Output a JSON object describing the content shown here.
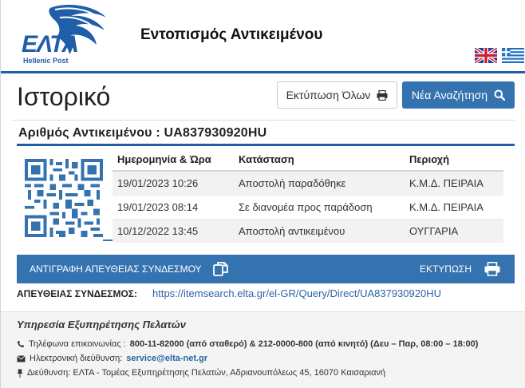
{
  "header": {
    "logo_text": "ΕΛΤΑ",
    "logo_subtext": "Hellenic Post",
    "title": "Εντοπισμός Αντικειμένου",
    "flags": [
      "uk-flag-icon",
      "greek-flag-icon"
    ]
  },
  "history": {
    "title": "Ιστορικό",
    "print_all_label": "Εκτύπωση Όλων",
    "new_search_label": "Νέα Αναζήτηση",
    "item_number_label": "Αριθμός Αντικειμένου : UA837930920HU"
  },
  "table": {
    "columns": [
      "Ημερομηνία & Ώρα",
      "Κατάσταση",
      "Περιοχή"
    ],
    "rows": [
      {
        "date": "19/01/2023 10:26",
        "status": "Αποστολή παραδόθηκε",
        "area": "Κ.Μ.Δ. ΠΕΙΡΑΙΑ"
      },
      {
        "date": "19/01/2023 08:14",
        "status": "Σε διανομέα προς παράδοση",
        "area": "Κ.Μ.Δ. ΠΕΙΡΑΙΑ"
      },
      {
        "date": "10/12/2022 13:45",
        "status": "Αποστολή αντικειμένου",
        "area": "ΟΥΓΓΑΡΙΑ"
      }
    ]
  },
  "actions": {
    "copy_link_label": "ΑΝΤΙΓΡΑΦΗ ΑΠΕΥΘΕΙΑΣ ΣΥΝΔΕΣΜΟΥ",
    "print_label": "ΕΚΤΥΠΩΣΗ"
  },
  "direct_link": {
    "label": "ΑΠΕΥΘΕΙΑΣ ΣΥΝΔΕΣΜΟΣ:",
    "url": "https://itemsearch.elta.gr/el-GR/Query/Direct/UA837930920HU"
  },
  "footer": {
    "title": "Υπηρεσία Εξυπηρέτησης Πελατών",
    "phone_label": "Τηλέφωνα επικοινωνίας :",
    "phone_value": "800-11-82000 (από σταθερό) & 212-0000-800 (από κινητό) (Δευ – Παρ, 08:00 – 18:00)",
    "email_label": "Ηλεκτρονική διεύθυνση:",
    "email_value": "service@elta-net.gr",
    "address": "Διεύθυνση: ΕΛΤΑ - Τομέας Εξυπηρέτησης Πελατών, Αδριανουπόλεως 45, 16070 Καισαριανή"
  },
  "colors": {
    "brand_blue": "#1f5ea8",
    "button_blue": "#3572b0",
    "link_blue": "#2a64a8"
  }
}
